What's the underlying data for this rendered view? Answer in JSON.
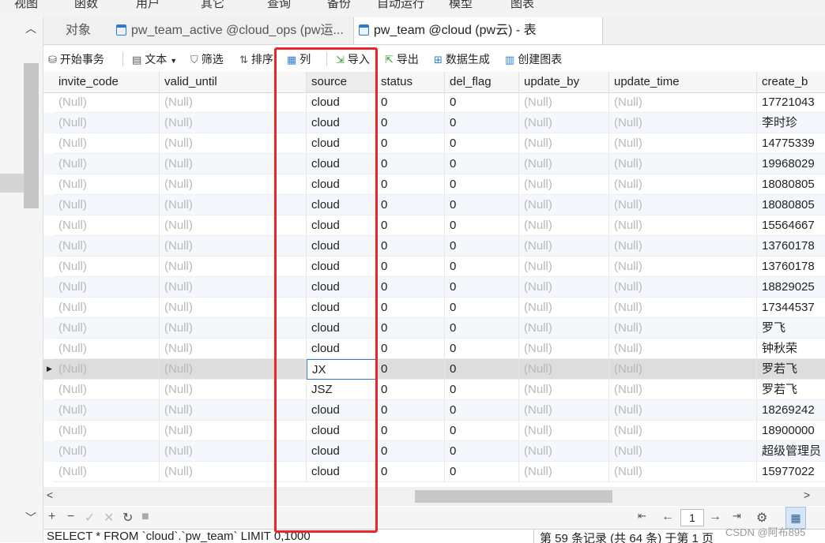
{
  "menu": [
    "视图",
    "函数",
    "用户",
    "其它",
    "查询",
    "备份",
    "自动运行",
    "模型",
    "图表"
  ],
  "tabs": {
    "objects": "对象",
    "tab1": "pw_team_active @cloud_ops (pw运...",
    "tab2": "pw_team @cloud (pw云) - 表"
  },
  "toolbar": {
    "begin_tx": "开始事务",
    "text": "文本",
    "filter": "筛选",
    "sort": "排序",
    "columns": "列",
    "import": "导入",
    "export": "导出",
    "data_gen": "数据生成",
    "create_chart": "创建图表"
  },
  "table": {
    "columns": [
      "invite_code",
      "valid_until",
      "source",
      "status",
      "del_flag",
      "update_by",
      "update_time",
      "create_b"
    ],
    "rows": [
      [
        "(Null)",
        "(Null)",
        "cloud",
        "0",
        "0",
        "(Null)",
        "(Null)",
        "17721043"
      ],
      [
        "(Null)",
        "(Null)",
        "cloud",
        "0",
        "0",
        "(Null)",
        "(Null)",
        "李时珍"
      ],
      [
        "(Null)",
        "(Null)",
        "cloud",
        "0",
        "0",
        "(Null)",
        "(Null)",
        "14775339"
      ],
      [
        "(Null)",
        "(Null)",
        "cloud",
        "0",
        "0",
        "(Null)",
        "(Null)",
        "19968029"
      ],
      [
        "(Null)",
        "(Null)",
        "cloud",
        "0",
        "0",
        "(Null)",
        "(Null)",
        "18080805"
      ],
      [
        "(Null)",
        "(Null)",
        "cloud",
        "0",
        "0",
        "(Null)",
        "(Null)",
        "18080805"
      ],
      [
        "(Null)",
        "(Null)",
        "cloud",
        "0",
        "0",
        "(Null)",
        "(Null)",
        "15564667"
      ],
      [
        "(Null)",
        "(Null)",
        "cloud",
        "0",
        "0",
        "(Null)",
        "(Null)",
        "13760178"
      ],
      [
        "(Null)",
        "(Null)",
        "cloud",
        "0",
        "0",
        "(Null)",
        "(Null)",
        "13760178"
      ],
      [
        "(Null)",
        "(Null)",
        "cloud",
        "0",
        "0",
        "(Null)",
        "(Null)",
        "18829025"
      ],
      [
        "(Null)",
        "(Null)",
        "cloud",
        "0",
        "0",
        "(Null)",
        "(Null)",
        "17344537"
      ],
      [
        "(Null)",
        "(Null)",
        "cloud",
        "0",
        "0",
        "(Null)",
        "(Null)",
        "罗飞"
      ],
      [
        "(Null)",
        "(Null)",
        "cloud",
        "0",
        "0",
        "(Null)",
        "(Null)",
        "钟秋荣"
      ],
      [
        "(Null)",
        "(Null)",
        "JX",
        "0",
        "0",
        "(Null)",
        "(Null)",
        "罗若飞"
      ],
      [
        "(Null)",
        "(Null)",
        "JSZ",
        "0",
        "0",
        "(Null)",
        "(Null)",
        "罗若飞"
      ],
      [
        "(Null)",
        "(Null)",
        "cloud",
        "0",
        "0",
        "(Null)",
        "(Null)",
        "18269242"
      ],
      [
        "(Null)",
        "(Null)",
        "cloud",
        "0",
        "0",
        "(Null)",
        "(Null)",
        "18900000"
      ],
      [
        "(Null)",
        "(Null)",
        "cloud",
        "0",
        "0",
        "(Null)",
        "(Null)",
        "超级管理员"
      ],
      [
        "(Null)",
        "(Null)",
        "cloud",
        "0",
        "0",
        "(Null)",
        "(Null)",
        "15977022"
      ]
    ]
  },
  "pager": {
    "page": "1"
  },
  "status": {
    "sql": "SELECT * FROM `cloud`.`pw_team` LIMIT 0,1000",
    "info": "第 59 条记录 (共 64 条) 于第 1 页"
  },
  "watermark": "CSDN @阿布895",
  "colors": {
    "highlight_box": "#e8262b",
    "accent": "#2d7bd1"
  }
}
